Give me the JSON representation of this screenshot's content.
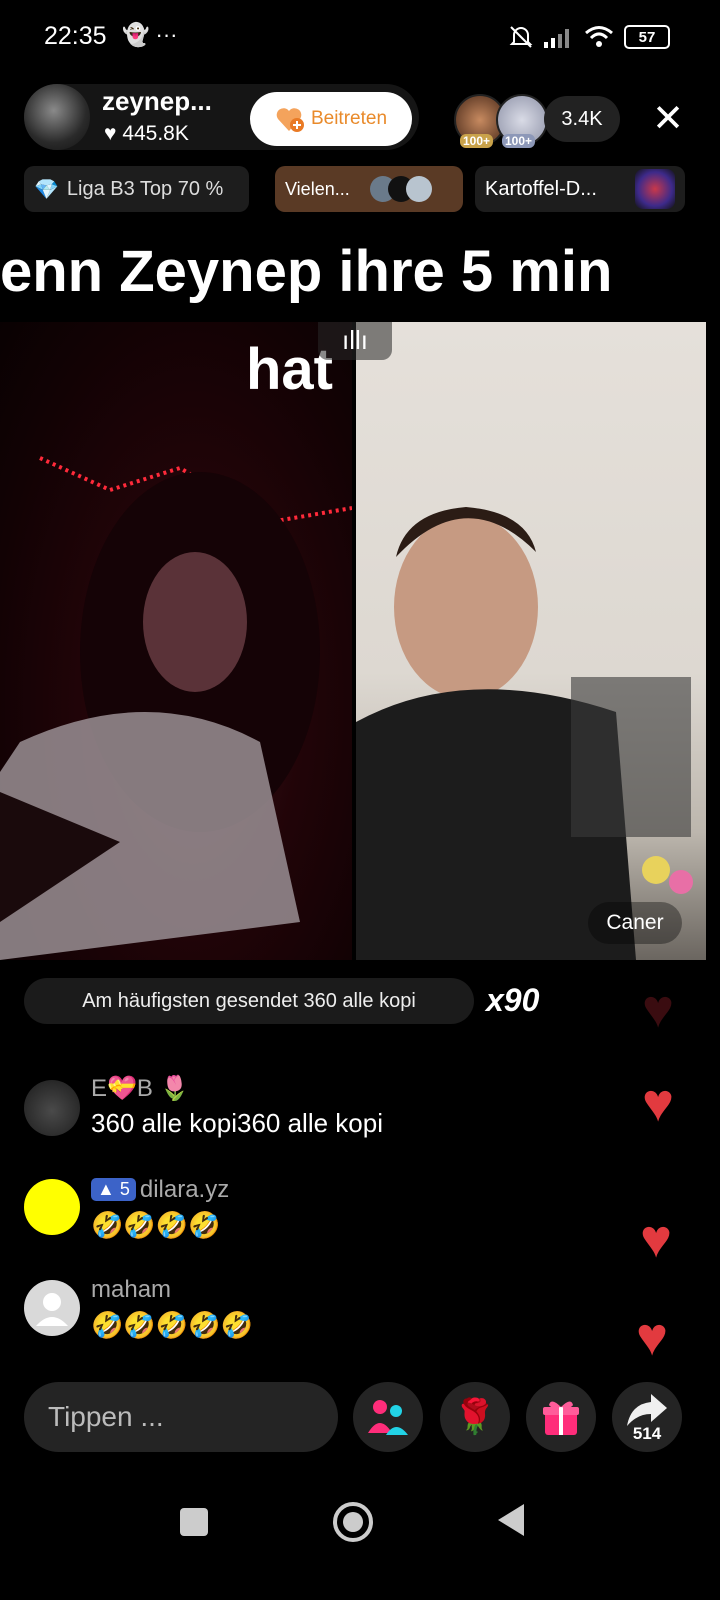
{
  "status_bar": {
    "time": "22:35",
    "extra_icons": "👻 ···",
    "battery": "57"
  },
  "host": {
    "name": "zeynep...",
    "likes": "445.8K",
    "join_label": "Beitreten"
  },
  "viewers": {
    "badge_1": "100+",
    "badge_2": "100+",
    "count": "3.4K"
  },
  "chips": {
    "league": "Liga B3 Top 70 %",
    "thanks": "Vielen...",
    "topic": "Kartoffel-D..."
  },
  "stream": {
    "overlay_line1": "enn Zeynep ihre 5 min",
    "overlay_line2": "hat",
    "guest_name": "Caner"
  },
  "most_sent": {
    "text": "Am häufigsten gesendet 360 alle kopi",
    "count": "x90"
  },
  "comments": [
    {
      "user": "E💝B 🌷",
      "text": "360 alle kopi360 alle kopi"
    },
    {
      "badge": "5",
      "user": "dilara.yz",
      "text": "🤣🤣🤣🤣"
    },
    {
      "user": "maham",
      "text": "🤣🤣🤣🤣🤣"
    }
  ],
  "input": {
    "placeholder": "Tippen ..."
  },
  "share": {
    "count": "514"
  },
  "colors": {
    "heart": "#e23a3f",
    "join_text": "#e98a2a",
    "thanks_chip": "#5a3a25"
  },
  "icons": [
    "silent-bell-icon",
    "signal-icon",
    "wifi-icon",
    "battery-icon",
    "heart-icon",
    "close-icon",
    "diamond-icon",
    "audio-bars-icon",
    "guest-icon",
    "rose-icon",
    "gift-icon",
    "share-icon",
    "square-nav-icon",
    "circle-nav-icon",
    "back-nav-icon"
  ]
}
